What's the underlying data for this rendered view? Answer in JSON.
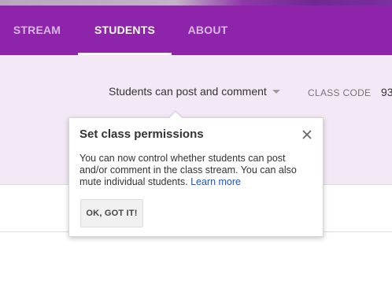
{
  "nav": {
    "tabs": [
      {
        "label": "STREAM",
        "active": false
      },
      {
        "label": "STUDENTS",
        "active": true
      },
      {
        "label": "ABOUT",
        "active": false
      }
    ]
  },
  "toolbar": {
    "permission_select_value": "Students can post and comment",
    "class_code_label": "CLASS CODE",
    "class_code_value": "93"
  },
  "popover": {
    "title": "Set class permissions",
    "body": "You can now control whether students can post and/or comment in the class stream. You can also mute individual students.",
    "link_label": "Learn more",
    "button_label": "OK, GOT IT!",
    "close_icon": "close-icon"
  },
  "colors": {
    "nav_background": "#8e24aa",
    "subheader_background": "#f3e8f5",
    "link": "#1a55c8"
  }
}
